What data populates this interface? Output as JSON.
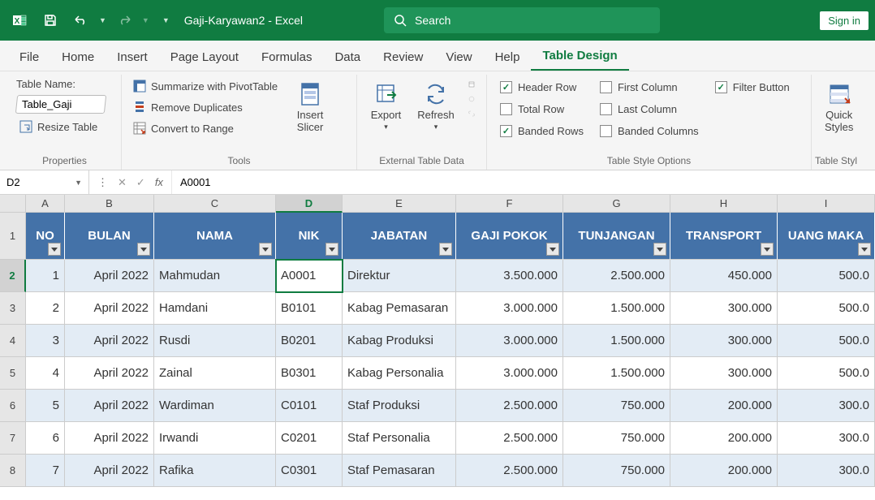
{
  "titlebar": {
    "filename": "Gaji-Karyawan2 - Excel",
    "search_placeholder": "Search",
    "signin": "Sign in"
  },
  "tabs": [
    "File",
    "Home",
    "Insert",
    "Page Layout",
    "Formulas",
    "Data",
    "Review",
    "View",
    "Help",
    "Table Design"
  ],
  "active_tab": "Table Design",
  "ribbon": {
    "properties": {
      "name_label": "Table Name:",
      "table_name": "Table_Gaji",
      "resize": "Resize Table",
      "group": "Properties"
    },
    "tools": {
      "pivot": "Summarize with PivotTable",
      "dup": "Remove Duplicates",
      "range": "Convert to Range",
      "slicer": "Insert Slicer",
      "group": "Tools"
    },
    "external": {
      "export": "Export",
      "refresh": "Refresh",
      "group": "External Table Data"
    },
    "styleopts": {
      "header_row": "Header Row",
      "total_row": "Total Row",
      "banded_rows": "Banded Rows",
      "first_col": "First Column",
      "last_col": "Last Column",
      "banded_cols": "Banded Columns",
      "filter_btn": "Filter Button",
      "group": "Table Style Options"
    },
    "tablestyles": {
      "quick": "Quick Styles",
      "group": "Table Styl"
    }
  },
  "namebox": "D2",
  "formula": "A0001",
  "columns": [
    "A",
    "B",
    "C",
    "D",
    "E",
    "F",
    "G",
    "H",
    "I"
  ],
  "selected_col": "D",
  "selected_row": 2,
  "headers": [
    "NO",
    "BULAN",
    "NAMA",
    "NIK",
    "JABATAN",
    "GAJI POKOK",
    "TUNJANGAN",
    "TRANSPORT",
    "UANG MAKA"
  ],
  "rows": [
    {
      "no": "1",
      "bulan": "April 2022",
      "nama": "Mahmudan",
      "nik": "A0001",
      "jabatan": "Direktur",
      "gaji": "3.500.000",
      "tunj": "2.500.000",
      "trans": "450.000",
      "uang": "500.0"
    },
    {
      "no": "2",
      "bulan": "April 2022",
      "nama": "Hamdani",
      "nik": "B0101",
      "jabatan": "Kabag Pemasaran",
      "gaji": "3.000.000",
      "tunj": "1.500.000",
      "trans": "300.000",
      "uang": "500.0"
    },
    {
      "no": "3",
      "bulan": "April 2022",
      "nama": "Rusdi",
      "nik": "B0201",
      "jabatan": "Kabag Produksi",
      "gaji": "3.000.000",
      "tunj": "1.500.000",
      "trans": "300.000",
      "uang": "500.0"
    },
    {
      "no": "4",
      "bulan": "April 2022",
      "nama": "Zainal",
      "nik": "B0301",
      "jabatan": "Kabag Personalia",
      "gaji": "3.000.000",
      "tunj": "1.500.000",
      "trans": "300.000",
      "uang": "500.0"
    },
    {
      "no": "5",
      "bulan": "April 2022",
      "nama": "Wardiman",
      "nik": "C0101",
      "jabatan": "Staf Produksi",
      "gaji": "2.500.000",
      "tunj": "750.000",
      "trans": "200.000",
      "uang": "300.0"
    },
    {
      "no": "6",
      "bulan": "April 2022",
      "nama": "Irwandi",
      "nik": "C0201",
      "jabatan": "Staf Personalia",
      "gaji": "2.500.000",
      "tunj": "750.000",
      "trans": "200.000",
      "uang": "300.0"
    },
    {
      "no": "7",
      "bulan": "April 2022",
      "nama": "Rafika",
      "nik": "C0301",
      "jabatan": "Staf Pemasaran",
      "gaji": "2.500.000",
      "tunj": "750.000",
      "trans": "200.000",
      "uang": "300.0"
    }
  ]
}
